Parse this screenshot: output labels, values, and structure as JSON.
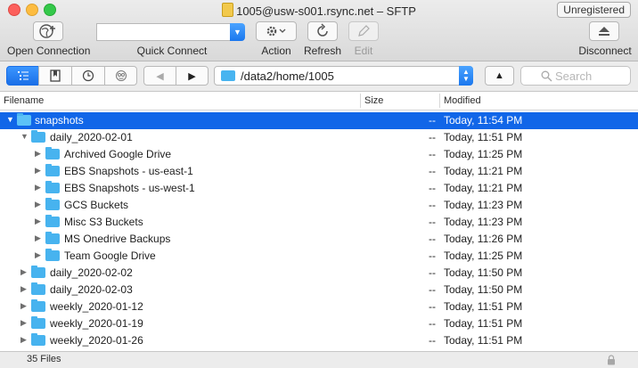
{
  "window": {
    "title": "1005@usw-s001.rsync.net – SFTP",
    "badge": "Unregistered"
  },
  "toolbar": {
    "open_connection": "Open Connection",
    "quick_connect": "Quick Connect",
    "quick_connect_value": "",
    "action": "Action",
    "refresh": "Refresh",
    "edit": "Edit",
    "disconnect": "Disconnect"
  },
  "navbar": {
    "path": "/data2/home/1005",
    "search_placeholder": "Search",
    "view_modes": [
      "browser-icon",
      "bookmarks-icon",
      "history-icon",
      "bonjour-icon"
    ],
    "active_view_mode": "browser-icon"
  },
  "columns": {
    "filename": "Filename",
    "size": "Size",
    "modified": "Modified"
  },
  "rows": [
    {
      "name": "snapshots",
      "size": "--",
      "modified": "Today, 11:54 PM",
      "selected": true,
      "expanded": true
    },
    {
      "name": "daily_2020-02-01",
      "size": "--",
      "modified": "Today, 11:51 PM",
      "expanded": true
    },
    {
      "name": "Archived Google Drive",
      "size": "--",
      "modified": "Today, 11:25 PM"
    },
    {
      "name": "EBS Snapshots - us-east-1",
      "size": "--",
      "modified": "Today, 11:21 PM"
    },
    {
      "name": "EBS Snapshots - us-west-1",
      "size": "--",
      "modified": "Today, 11:21 PM"
    },
    {
      "name": "GCS Buckets",
      "size": "--",
      "modified": "Today, 11:23 PM"
    },
    {
      "name": "Misc S3 Buckets",
      "size": "--",
      "modified": "Today, 11:23 PM"
    },
    {
      "name": "MS Onedrive Backups",
      "size": "--",
      "modified": "Today, 11:26 PM"
    },
    {
      "name": "Team Google Drive",
      "size": "--",
      "modified": "Today, 11:25 PM"
    },
    {
      "name": "daily_2020-02-02",
      "size": "--",
      "modified": "Today, 11:50 PM"
    },
    {
      "name": "daily_2020-02-03",
      "size": "--",
      "modified": "Today, 11:50 PM"
    },
    {
      "name": "weekly_2020-01-12",
      "size": "--",
      "modified": "Today, 11:51 PM"
    },
    {
      "name": "weekly_2020-01-19",
      "size": "--",
      "modified": "Today, 11:51 PM"
    },
    {
      "name": "weekly_2020-01-26",
      "size": "--",
      "modified": "Today, 11:51 PM"
    }
  ],
  "status": {
    "count": "35 Files"
  },
  "colors": {
    "selection": "#1166e8",
    "folder": "#47b3ef",
    "accent": "#1a77ee"
  }
}
